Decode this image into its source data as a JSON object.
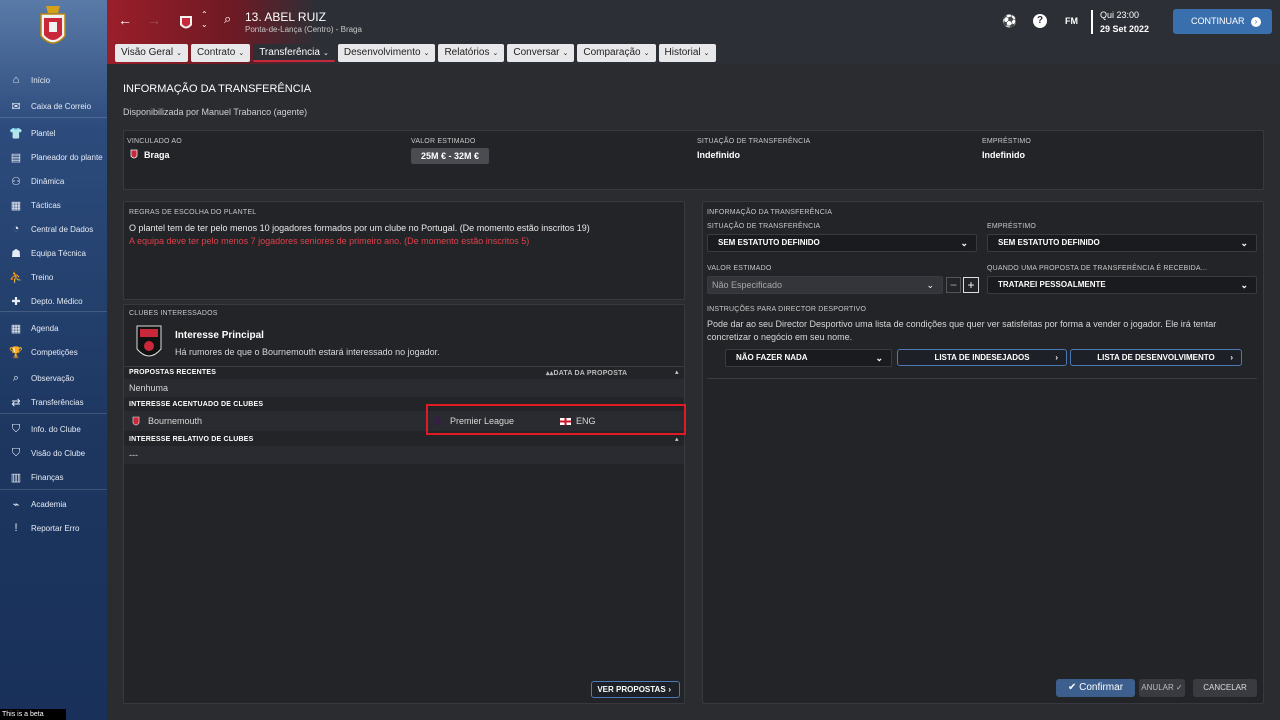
{
  "sidebar": {
    "items": [
      {
        "label": "Início",
        "icon": "home-icon",
        "glyph": "⌂"
      },
      {
        "label": "Caixa de Correio",
        "icon": "inbox-icon",
        "glyph": "✉"
      },
      {
        "label": "Plantel",
        "icon": "shirt-icon",
        "glyph": "👕"
      },
      {
        "label": "Planeador do plantel",
        "icon": "planner-icon",
        "glyph": "▤"
      },
      {
        "label": "Dinâmica",
        "icon": "dynamics-icon",
        "glyph": "⚇"
      },
      {
        "label": "Tácticas",
        "icon": "tactics-icon",
        "glyph": "▦"
      },
      {
        "label": "Central de Dados",
        "icon": "data-hub-icon",
        "glyph": "◔"
      },
      {
        "label": "Equipa Técnica",
        "icon": "staff-icon",
        "glyph": "☗"
      },
      {
        "label": "Treino",
        "icon": "training-icon",
        "glyph": "⛹"
      },
      {
        "label": "Depto. Médico",
        "icon": "medical-icon",
        "glyph": "✚"
      },
      {
        "label": "Agenda",
        "icon": "calendar-icon",
        "glyph": "▦"
      },
      {
        "label": "Competições",
        "icon": "trophy-icon",
        "glyph": "🏆"
      },
      {
        "label": "Observação",
        "icon": "scouting-icon",
        "glyph": "⌕"
      },
      {
        "label": "Transferências",
        "icon": "transfers-icon",
        "glyph": "⇄"
      },
      {
        "label": "Info. do Clube",
        "icon": "club-info-icon",
        "glyph": "⛉"
      },
      {
        "label": "Visão do Clube",
        "icon": "club-vision-icon",
        "glyph": "⛉"
      },
      {
        "label": "Finanças",
        "icon": "finances-icon",
        "glyph": "▥"
      },
      {
        "label": "Academia",
        "icon": "academy-icon",
        "glyph": "⌁"
      },
      {
        "label": "Reportar Erro",
        "icon": "report-bug-icon",
        "glyph": "!"
      }
    ],
    "beta_label": "This is a beta version"
  },
  "header": {
    "player_name": "13. ABEL RUIZ",
    "player_subtitle": "Ponta-de-Lança (Centro) - Braga",
    "tabs": [
      {
        "label": "Visão Geral"
      },
      {
        "label": "Contrato"
      },
      {
        "label": "Transferência",
        "active": true
      },
      {
        "label": "Desenvolvimento"
      },
      {
        "label": "Relatórios"
      },
      {
        "label": "Conversar"
      },
      {
        "label": "Comparação"
      },
      {
        "label": "Historial"
      }
    ],
    "fm_label": "FM",
    "date_line1": "Qui 23:00",
    "date_line2": "29 Set 2022",
    "continue_label": "CONTINUAR",
    "accent_color": "#3a6fae",
    "brand_color": "#9a1e2a"
  },
  "main": {
    "title": "INFORMAÇÃO DA TRANSFERÊNCIA",
    "subtitle": "Disponibilizada por Manuel Trabanco (agente)",
    "summary": {
      "contracted_caption": "VINCULADO AO",
      "contracted_value": "Braga",
      "estimated_caption": "VALOR ESTIMADO",
      "estimated_value": "25M € - 32M €",
      "transfer_status_caption": "SITUAÇÃO DE TRANSFERÊNCIA",
      "transfer_status_value": "Indefinido",
      "loan_caption": "EMPRÉSTIMO",
      "loan_value": "Indefinido"
    },
    "rules": {
      "caption": "REGRAS DE ESCOLHA DO PLANTEL",
      "line1": "O plantel tem de ter pelo menos 10 jogadores formados por um clube no Portugal. (De momento estão inscritos 19)",
      "line2": "A equipa deve ter pelo menos 7 jogadores seniores de primeiro ano. (De momento estão inscritos 5)"
    },
    "interested": {
      "caption": "CLUBES INTERESSADOS",
      "main_title": "Interesse Principal",
      "main_text": "Há rumores de que o Bournemouth estará interessado no jogador.",
      "recent_caption": "PROPOSTAS RECENTES",
      "date_caption": "DATA DA PROPOSTA",
      "recent_value": "Nenhuma",
      "strong_caption": "INTERESSE ACENTUADO DE CLUBES",
      "strong_club": "Bournemouth",
      "strong_league": "Premier League",
      "strong_nation": "ENG",
      "relative_caption": "INTERESSE RELATIVO DE CLUBES",
      "relative_value": "---",
      "view_offers": "VER PROPOSTAS"
    },
    "info": {
      "caption": "INFORMAÇÃO DA TRANSFERÊNCIA",
      "status_caption": "SITUAÇÃO DE TRANSFERÊNCIA",
      "status_value": "SEM ESTATUTO DEFINIDO",
      "loan_caption": "EMPRÉSTIMO",
      "loan_value": "SEM ESTATUTO DEFINIDO",
      "estimated_caption": "VALOR ESTIMADO",
      "estimated_placeholder": "Não Especificado",
      "offer_caption": "QUANDO UMA PROPOSTA DE TRANSFERÊNCIA É RECEBIDA...",
      "offer_value": "TRATAREI PESSOALMENTE",
      "director_caption": "INSTRUÇÕES PARA DIRECTOR DESPORTIVO",
      "director_text": "Pode dar ao seu Director Desportivo uma lista de condições que quer ver satisfeitas por forma a vender o jogador. Ele irá tentar concretizar o negócio em seu nome.",
      "action_value": "NÃO FAZER NADA",
      "unwanted_label": "LISTA DE INDESEJADOS",
      "development_label": "LISTA DE DESENVOLVIMENTO",
      "confirm_label": "Confirmar",
      "undo_label": "ANULAR",
      "cancel_label": "CANCELAR"
    }
  }
}
